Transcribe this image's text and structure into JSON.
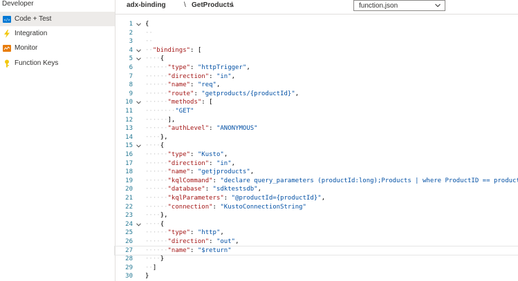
{
  "sidebar": {
    "title": "Developer",
    "items": [
      {
        "label": "Code + Test",
        "icon": "code-icon",
        "selected": true
      },
      {
        "label": "Integration",
        "icon": "lightning-icon",
        "selected": false
      },
      {
        "label": "Monitor",
        "icon": "monitor-icon",
        "selected": false
      },
      {
        "label": "Function Keys",
        "icon": "key-icon",
        "selected": false
      }
    ]
  },
  "header": {
    "app": "adx-binding",
    "sep1": "\\",
    "function": "GetProducts",
    "sep2": "\\",
    "file": "function.json"
  },
  "editor": {
    "lines": [
      {
        "n": "1",
        "fold": true,
        "ws": "",
        "t": [
          [
            "p",
            "{"
          ]
        ]
      },
      {
        "n": "2",
        "fold": false,
        "ws": "··",
        "t": []
      },
      {
        "n": "3",
        "fold": false,
        "ws": "··",
        "t": []
      },
      {
        "n": "4",
        "fold": true,
        "ws": "··",
        "t": [
          [
            "k",
            "\"bindings\""
          ],
          [
            "p",
            ": ["
          ]
        ]
      },
      {
        "n": "5",
        "fold": true,
        "ws": "····",
        "t": [
          [
            "p",
            "{"
          ]
        ]
      },
      {
        "n": "6",
        "fold": false,
        "ws": "······",
        "t": [
          [
            "k",
            "\"type\""
          ],
          [
            "p",
            ": "
          ],
          [
            "s",
            "\"httpTrigger\""
          ],
          [
            "p",
            ","
          ]
        ]
      },
      {
        "n": "7",
        "fold": false,
        "ws": "······",
        "t": [
          [
            "k",
            "\"direction\""
          ],
          [
            "p",
            ": "
          ],
          [
            "s",
            "\"in\""
          ],
          [
            "p",
            ","
          ]
        ]
      },
      {
        "n": "8",
        "fold": false,
        "ws": "······",
        "t": [
          [
            "k",
            "\"name\""
          ],
          [
            "p",
            ": "
          ],
          [
            "s",
            "\"req\""
          ],
          [
            "p",
            ","
          ]
        ]
      },
      {
        "n": "9",
        "fold": false,
        "ws": "······",
        "t": [
          [
            "k",
            "\"route\""
          ],
          [
            "p",
            ": "
          ],
          [
            "s",
            "\"getproducts/{productId}\""
          ],
          [
            "p",
            ","
          ]
        ]
      },
      {
        "n": "10",
        "fold": true,
        "ws": "······",
        "t": [
          [
            "k",
            "\"methods\""
          ],
          [
            "p",
            ": ["
          ]
        ]
      },
      {
        "n": "11",
        "fold": false,
        "ws": "········",
        "t": [
          [
            "s",
            "\"GET\""
          ]
        ]
      },
      {
        "n": "12",
        "fold": false,
        "ws": "······",
        "t": [
          [
            "p",
            "],"
          ]
        ]
      },
      {
        "n": "13",
        "fold": false,
        "ws": "······",
        "t": [
          [
            "k",
            "\"authLevel\""
          ],
          [
            "p",
            ": "
          ],
          [
            "s",
            "\"ANONYMOUS\""
          ]
        ]
      },
      {
        "n": "14",
        "fold": false,
        "ws": "····",
        "t": [
          [
            "p",
            "},"
          ]
        ]
      },
      {
        "n": "15",
        "fold": true,
        "ws": "····",
        "t": [
          [
            "p",
            "{"
          ]
        ]
      },
      {
        "n": "16",
        "fold": false,
        "ws": "······",
        "t": [
          [
            "k",
            "\"type\""
          ],
          [
            "p",
            ": "
          ],
          [
            "s",
            "\"Kusto\""
          ],
          [
            "p",
            ","
          ]
        ]
      },
      {
        "n": "17",
        "fold": false,
        "ws": "······",
        "t": [
          [
            "k",
            "\"direction\""
          ],
          [
            "p",
            ": "
          ],
          [
            "s",
            "\"in\""
          ],
          [
            "p",
            ","
          ]
        ]
      },
      {
        "n": "18",
        "fold": false,
        "ws": "······",
        "t": [
          [
            "k",
            "\"name\""
          ],
          [
            "p",
            ": "
          ],
          [
            "s",
            "\"getjproducts\""
          ],
          [
            "p",
            ","
          ]
        ]
      },
      {
        "n": "19",
        "fold": false,
        "ws": "······",
        "t": [
          [
            "k",
            "\"kqlCommand\""
          ],
          [
            "p",
            ": "
          ],
          [
            "s",
            "\"declare query_parameters (productId:long);Products | where ProductID == productId\""
          ],
          [
            "p",
            ","
          ]
        ]
      },
      {
        "n": "20",
        "fold": false,
        "ws": "······",
        "t": [
          [
            "k",
            "\"database\""
          ],
          [
            "p",
            ": "
          ],
          [
            "s",
            "\"sdktestsdb\""
          ],
          [
            "p",
            ","
          ]
        ]
      },
      {
        "n": "21",
        "fold": false,
        "ws": "······",
        "t": [
          [
            "k",
            "\"kqlParameters\""
          ],
          [
            "p",
            ": "
          ],
          [
            "s",
            "\"@productId={productId}\""
          ],
          [
            "p",
            ","
          ]
        ]
      },
      {
        "n": "22",
        "fold": false,
        "ws": "······",
        "t": [
          [
            "k",
            "\"connection\""
          ],
          [
            "p",
            ": "
          ],
          [
            "s",
            "\"KustoConnectionString\""
          ]
        ]
      },
      {
        "n": "23",
        "fold": false,
        "ws": "····",
        "t": [
          [
            "p",
            "},"
          ]
        ]
      },
      {
        "n": "24",
        "fold": true,
        "ws": "····",
        "t": [
          [
            "p",
            "{"
          ]
        ]
      },
      {
        "n": "25",
        "fold": false,
        "ws": "······",
        "t": [
          [
            "k",
            "\"type\""
          ],
          [
            "p",
            ": "
          ],
          [
            "s",
            "\"http\""
          ],
          [
            "p",
            ","
          ]
        ]
      },
      {
        "n": "26",
        "fold": false,
        "ws": "······",
        "t": [
          [
            "k",
            "\"direction\""
          ],
          [
            "p",
            ": "
          ],
          [
            "s",
            "\"out\""
          ],
          [
            "p",
            ","
          ]
        ]
      },
      {
        "n": "27",
        "fold": false,
        "ws": "······",
        "t": [
          [
            "k",
            "\"name\""
          ],
          [
            "p",
            ": "
          ],
          [
            "s",
            "\"$return\""
          ]
        ],
        "active": true
      },
      {
        "n": "28",
        "fold": false,
        "ws": "····",
        "t": [
          [
            "p",
            "}"
          ]
        ]
      },
      {
        "n": "29",
        "fold": false,
        "ws": "··",
        "t": [
          [
            "p",
            "]"
          ]
        ]
      },
      {
        "n": "30",
        "fold": false,
        "ws": "",
        "t": [
          [
            "p",
            "}"
          ]
        ]
      }
    ]
  }
}
